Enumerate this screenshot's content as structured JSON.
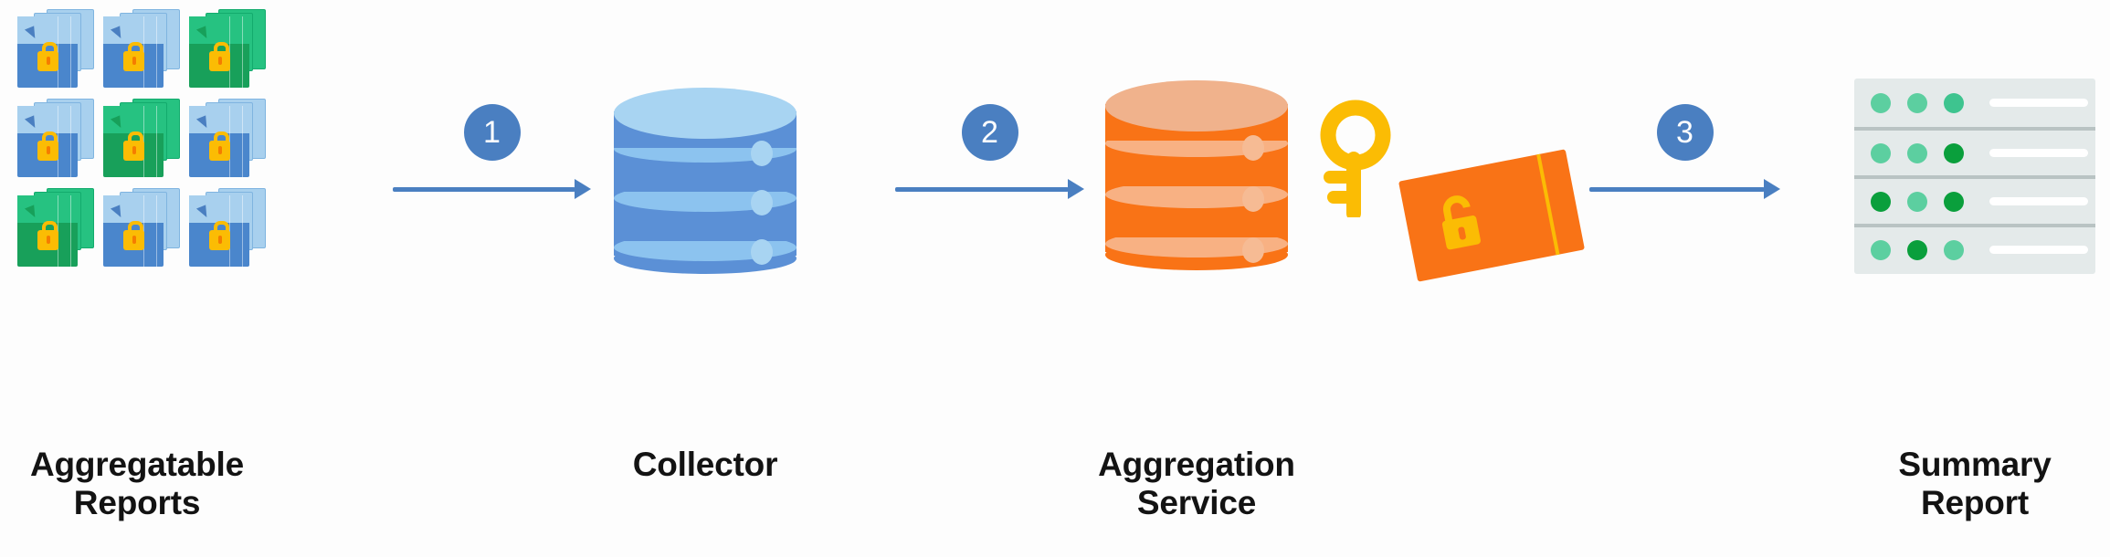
{
  "diagram": {
    "title": "Aggregatable Reports to Summary Report flow",
    "background": "#fdfdfd",
    "colors": {
      "step_badge": "#4a7fc1",
      "arrow": "#4a7fc1",
      "collector_cylinder": "#5b90d6",
      "collector_top": "#a8d4f2",
      "aggregation_cylinder": "#f97316",
      "aggregation_top": "#f0b28c",
      "key": "#fbbc04",
      "lock": "#fbbc04",
      "report_blue": "#4a86cc",
      "report_blue_light": "#a8d0ee",
      "report_green": "#18a05a",
      "report_green_light": "#26c281",
      "summary_panel": "#e4eaea",
      "summary_dot": "#5ccfa0",
      "summary_dot_dark": "#0a9f3c",
      "summary_bar": "#ffffff",
      "label_text": "#131313"
    }
  },
  "nodes": {
    "reports": {
      "label": "Aggregatable\nReports",
      "icon": "encrypted-documents-stack-icon",
      "grid": [
        [
          "blue",
          "blue",
          "green"
        ],
        [
          "blue",
          "green",
          "blue"
        ],
        [
          "green",
          "blue",
          "blue"
        ]
      ],
      "count": 9
    },
    "collector": {
      "label": "Collector",
      "icon": "database-cylinder-icon",
      "segments": 3,
      "dots": 3
    },
    "aggregation": {
      "label": "Aggregation\nService",
      "icon": "database-cylinder-icon",
      "segments": 3,
      "dots": 3,
      "key_icon": "key-icon",
      "card_icon": "unlocked-envelope-icon"
    },
    "summary": {
      "label": "Summary\nReport",
      "icon": "summary-report-panel-icon",
      "rows": [
        {
          "dots": [
            "light",
            "light",
            "light"
          ],
          "bar": true
        },
        {
          "dots": [
            "light",
            "light",
            "dark"
          ],
          "bar": true
        },
        {
          "dots": [
            "dark",
            "light",
            "dark"
          ],
          "bar": true
        },
        {
          "dots": [
            "light",
            "dark",
            "light"
          ],
          "bar": true
        }
      ]
    }
  },
  "steps": [
    {
      "number": "1",
      "from": "Aggregatable Reports",
      "to": "Collector"
    },
    {
      "number": "2",
      "from": "Collector",
      "to": "Aggregation Service"
    },
    {
      "number": "3",
      "from": "Aggregation Service",
      "to": "Summary Report"
    }
  ]
}
